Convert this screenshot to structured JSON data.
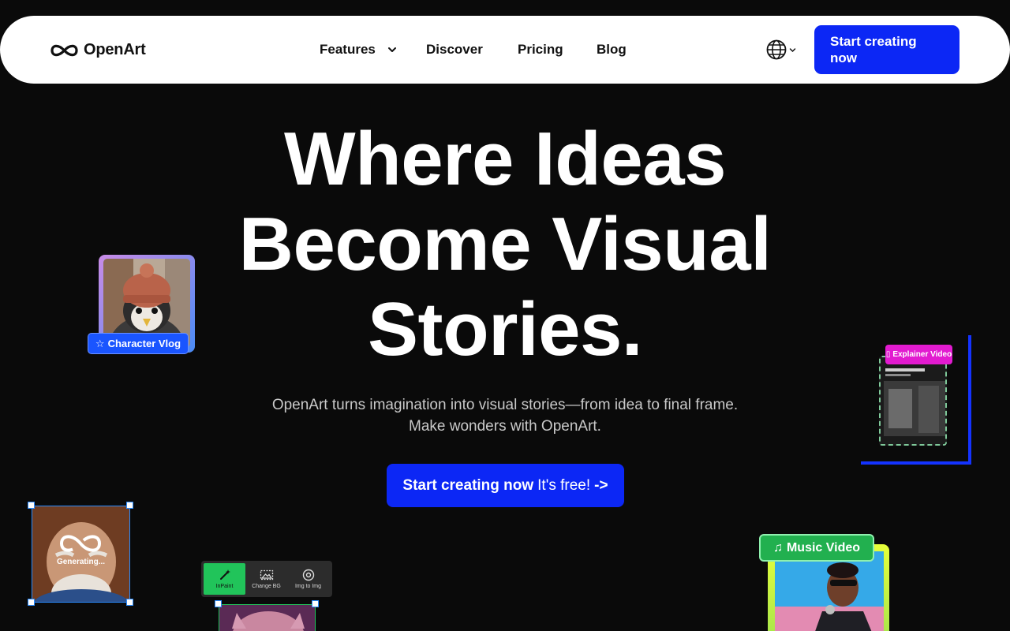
{
  "nav": {
    "logo_text": "OpenArt",
    "links": {
      "features": "Features",
      "discover": "Discover",
      "pricing": "Pricing",
      "blog": "Blog"
    },
    "language_icon": "globe-icon",
    "cta_label": "Start creating now"
  },
  "hero": {
    "title_line1": "Where Ideas",
    "title_line2": "Become Visual",
    "title_line3": "Stories.",
    "subtitle_line1": "OpenArt turns imagination into visual stories—from idea to final frame.",
    "subtitle_line2": "Make wonders with OpenArt.",
    "cta_bold": "Start creating now",
    "cta_regular": "It's free!",
    "cta_arrow": "->"
  },
  "cards": {
    "character_vlog": "Character Vlog",
    "explainer_video": "Explainer Video",
    "generating": "Generating...",
    "music_video": "Music Video",
    "tools": [
      "InPaint",
      "Change BG",
      "Img to Img"
    ]
  },
  "colors": {
    "background": "#0a0a0a",
    "primary_blue": "#0c27f5",
    "tag_blue": "#1a55ff",
    "tag_magenta": "#e21bd0",
    "tag_green": "#22b04f",
    "selection_blue": "#2b8cff",
    "tool_active_green": "#21c45a"
  }
}
